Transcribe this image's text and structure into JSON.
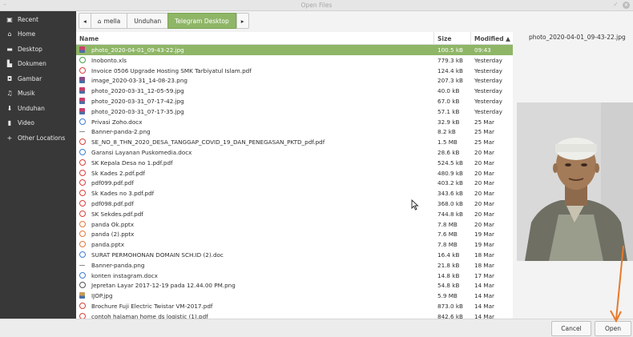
{
  "window": {
    "title": "Open Files"
  },
  "sidebar": {
    "items": [
      {
        "label": "Recent",
        "icon": "recent-icon"
      },
      {
        "label": "Home",
        "icon": "home-icon"
      },
      {
        "label": "Desktop",
        "icon": "desktop-icon"
      },
      {
        "label": "Dokumen",
        "icon": "document-icon"
      },
      {
        "label": "Gambar",
        "icon": "camera-icon"
      },
      {
        "label": "Musik",
        "icon": "music-icon"
      },
      {
        "label": "Unduhan",
        "icon": "download-icon"
      },
      {
        "label": "Video",
        "icon": "video-icon"
      },
      {
        "label": "Other Locations",
        "icon": "plus-icon"
      }
    ]
  },
  "pathbar": {
    "crumbs": [
      {
        "label": "mella"
      },
      {
        "label": "Unduhan"
      },
      {
        "label": "Telegram Desktop"
      }
    ]
  },
  "columns": {
    "name": "Name",
    "size": "Size",
    "modified": "Modified ▲"
  },
  "files": [
    {
      "name": "photo_2020-04-01_09-43-22.jpg",
      "size": "100.5 kB",
      "modified": "09:43",
      "type": "image",
      "color": "#c9416b"
    },
    {
      "name": "Inobonto.xls",
      "size": "779.3 kB",
      "modified": "Yesterday",
      "type": "spreadsheet",
      "color": "#4aa34a"
    },
    {
      "name": "Invoice 0506 Upgrade Hosting SMK Tarbiyatul Islam.pdf",
      "size": "124.4 kB",
      "modified": "Yesterday",
      "type": "pdf",
      "color": "#d9403a"
    },
    {
      "name": "image_2020-03-31_14-08-23.png",
      "size": "207.3 kB",
      "modified": "Yesterday",
      "type": "image",
      "color": "#8a4e8a"
    },
    {
      "name": "photo_2020-03-31_12-05-59.jpg",
      "size": "40.0 kB",
      "modified": "Yesterday",
      "type": "image",
      "color": "#c9416b"
    },
    {
      "name": "photo_2020-03-31_07-17-42.jpg",
      "size": "67.0 kB",
      "modified": "Yesterday",
      "type": "image",
      "color": "#c9416b"
    },
    {
      "name": "photo_2020-03-31_07-17-35.jpg",
      "size": "57.1 kB",
      "modified": "Yesterday",
      "type": "image",
      "color": "#c9416b"
    },
    {
      "name": "Privasi Zoho.docx",
      "size": "32.9 kB",
      "modified": "25 Mar",
      "type": "doc",
      "color": "#3f7dd1"
    },
    {
      "name": "Banner-panda-2.png",
      "size": "8.2 kB",
      "modified": "25 Mar",
      "type": "blank",
      "color": "#888888"
    },
    {
      "name": "SE_NO_8_THN_2020_DESA_TANGGAP_COVID_19_DAN_PENEGASAN_PKTD_pdf.pdf",
      "size": "1.5 MB",
      "modified": "25 Mar",
      "type": "pdf",
      "color": "#d9403a"
    },
    {
      "name": "Garansi Layanan Puskomedia.docx",
      "size": "28.6 kB",
      "modified": "20 Mar",
      "type": "doc",
      "color": "#3f7dd1"
    },
    {
      "name": "SK Kepala Desa no 1.pdf.pdf",
      "size": "524.5 kB",
      "modified": "20 Mar",
      "type": "pdf",
      "color": "#d9403a"
    },
    {
      "name": "Sk Kades 2.pdf.pdf",
      "size": "480.9 kB",
      "modified": "20 Mar",
      "type": "pdf",
      "color": "#d9403a"
    },
    {
      "name": "pdf099.pdf.pdf",
      "size": "403.2 kB",
      "modified": "20 Mar",
      "type": "pdf",
      "color": "#d9403a"
    },
    {
      "name": "Sk Kades no 3.pdf.pdf",
      "size": "343.6 kB",
      "modified": "20 Mar",
      "type": "pdf",
      "color": "#d9403a"
    },
    {
      "name": "pdf098.pdf.pdf",
      "size": "368.0 kB",
      "modified": "20 Mar",
      "type": "pdf",
      "color": "#d9403a"
    },
    {
      "name": "SK Sekdes.pdf.pdf",
      "size": "744.8 kB",
      "modified": "20 Mar",
      "type": "pdf",
      "color": "#d9403a"
    },
    {
      "name": "panda Ok.pptx",
      "size": "7.8 MB",
      "modified": "20 Mar",
      "type": "presentation",
      "color": "#e07a3b"
    },
    {
      "name": "panda (2).pptx",
      "size": "7.6 MB",
      "modified": "19 Mar",
      "type": "presentation",
      "color": "#e07a3b"
    },
    {
      "name": "panda.pptx",
      "size": "7.8 MB",
      "modified": "19 Mar",
      "type": "presentation",
      "color": "#e07a3b"
    },
    {
      "name": "SURAT PERMOHONAN DOMAIN SCH.ID (2).doc",
      "size": "16.4 kB",
      "modified": "18 Mar",
      "type": "doc",
      "color": "#3f7dd1"
    },
    {
      "name": "Banner-panda.png",
      "size": "21.8 kB",
      "modified": "18 Mar",
      "type": "blank",
      "color": "#888888"
    },
    {
      "name": "konten instagram.docx",
      "size": "14.8 kB",
      "modified": "17 Mar",
      "type": "doc",
      "color": "#3f7dd1"
    },
    {
      "name": "Jepretan Layar 2017-12-19 pada 12.44.00 PM.png",
      "size": "54.8 kB",
      "modified": "14 Mar",
      "type": "file",
      "color": "#555555"
    },
    {
      "name": "IJOP.jpg",
      "size": "5.9 MB",
      "modified": "14 Mar",
      "type": "image",
      "color": "#c99a5a"
    },
    {
      "name": "Brochure Fuji Electric Twistar VM-2017.pdf",
      "size": "873.0 kB",
      "modified": "14 Mar",
      "type": "pdf",
      "color": "#d9403a"
    },
    {
      "name": "contoh halaman home ds logistic (1).pdf",
      "size": "842.6 kB",
      "modified": "14 Mar",
      "type": "pdf",
      "color": "#d9403a"
    }
  ],
  "preview": {
    "filename": "photo_2020-04-01_09-43-22.jpg"
  },
  "buttons": {
    "cancel": "Cancel",
    "open": "Open"
  },
  "colors": {
    "accent": "#8fb667",
    "sidebar": "#383838",
    "annotation": "#e8792a"
  }
}
